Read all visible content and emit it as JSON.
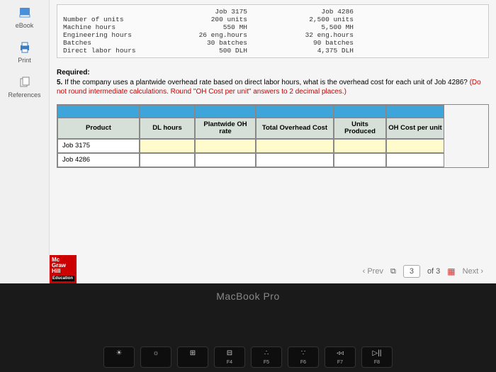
{
  "sidebar": {
    "ebook": "eBook",
    "print": "Print",
    "references": "References"
  },
  "givens": {
    "col_job1": "Job 3175",
    "col_job2": "Job 4286",
    "r1": {
      "label": "Number of units",
      "a": "200 units",
      "b": "2,500 units"
    },
    "r2": {
      "label": "Machine hours",
      "a": "550 MH",
      "b": "5,500 MH"
    },
    "r3": {
      "label": "Engineering hours",
      "a": "26 eng.hours",
      "b": "32 eng.hours"
    },
    "r4": {
      "label": "Batches",
      "a": "30 batches",
      "b": "90 batches"
    },
    "r5": {
      "label": "Direct labor hours",
      "a": "500 DLH",
      "b": "4,375 DLH"
    }
  },
  "required": {
    "head": "Required:",
    "num": "5.",
    "text": "If the company uses a plantwide overhead rate based on direct labor hours, what is the overhead cost for each unit of Job 4286?",
    "note": "(Do not round intermediate calculations. Round \"OH Cost per unit\" answers to 2 decimal places.)"
  },
  "table": {
    "h1": "Product",
    "h2": "DL hours",
    "h3": "Plantwide OH rate",
    "h4": "Total Overhead Cost",
    "h5": "Units Produced",
    "h6": "OH Cost per unit",
    "row1": "Job 3175",
    "row2": "Job 4286"
  },
  "pager": {
    "prev": "Prev",
    "current": "3",
    "of": "of 3",
    "next": "Next"
  },
  "logo": {
    "l1": "Mc",
    "l2": "Graw",
    "l3": "Hill",
    "edu": "Education"
  },
  "laptop": "MacBook Pro",
  "keys": {
    "k1": {
      "sym": "☀",
      "label": ""
    },
    "k2": {
      "sym": "☼",
      "label": ""
    },
    "k3": {
      "sym": "⊞",
      "label": ""
    },
    "k4": {
      "sym": "⊟",
      "label": "F4"
    },
    "k5": {
      "sym": "∴",
      "label": "F5"
    },
    "k6": {
      "sym": "∵",
      "label": "F6"
    },
    "k7": {
      "sym": "◃◃",
      "label": "F7"
    },
    "k8": {
      "sym": "▷||",
      "label": "F8"
    }
  }
}
